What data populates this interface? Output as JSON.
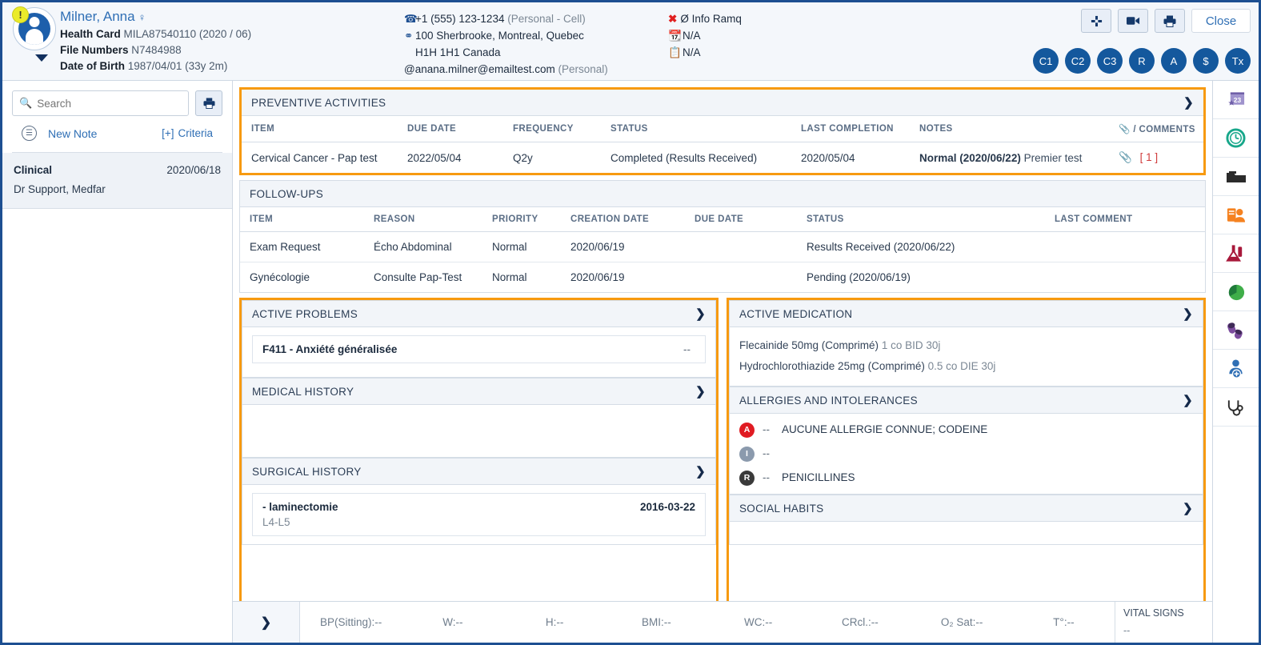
{
  "patient": {
    "name": "Milner, Anna",
    "gender_icon": "female-icon",
    "alert_badge": "!",
    "health_card_label": "Health Card",
    "health_card_value": "MILA87540110 (2020 / 06)",
    "file_numbers_label": "File Numbers",
    "file_numbers_value": "N7484988",
    "dob_label": "Date of Birth",
    "dob_value": "1987/04/01 (33y 2m)"
  },
  "contact": {
    "phone": "+1 (555) 123-1234",
    "phone_type": "(Personal - Cell)",
    "address_line1": "100 Sherbrooke, Montreal, Quebec",
    "address_line2": "H1H 1H1 Canada",
    "email": "@anana.milner@emailtest.com",
    "email_type": "(Personal)"
  },
  "ramq": {
    "info_label": "Ø Info Ramq",
    "row2": "N/A",
    "row3": "N/A"
  },
  "header_actions": {
    "expand_label": "expand-icon",
    "video_label": "video-icon",
    "print_label": "print-icon",
    "close_label": "Close",
    "circles": [
      "C1",
      "C2",
      "C3",
      "R",
      "A",
      "$",
      "Tx"
    ]
  },
  "notes_panel": {
    "search_placeholder": "Search",
    "search_value": "",
    "print_icon": "print-icon",
    "new_note_label": "New Note",
    "criteria_plus": "[+]",
    "criteria_label": "Criteria",
    "note": {
      "title": "Clinical",
      "date": "2020/06/18",
      "author": "Dr Support, Medfar"
    }
  },
  "preventive_activities": {
    "title": "PREVENTIVE ACTIVITIES",
    "columns": [
      "ITEM",
      "DUE DATE",
      "FREQUENCY",
      "STATUS",
      "LAST COMPLETION",
      "NOTES",
      "/ COMMENTS"
    ],
    "rows": [
      {
        "item": "Cervical Cancer - Pap test",
        "due_date": "2022/05/04",
        "frequency": "Q2y",
        "status": "Completed (Results Received)",
        "last_completion": "2020/05/04",
        "notes_bold": "Normal (2020/06/22)",
        "notes_rest": "Premier test",
        "comment_count": "[ 1 ]"
      }
    ]
  },
  "follow_ups": {
    "title": "FOLLOW-UPS",
    "columns": [
      "ITEM",
      "REASON",
      "PRIORITY",
      "CREATION DATE",
      "DUE DATE",
      "STATUS",
      "LAST COMMENT"
    ],
    "rows": [
      {
        "item": "Exam Request",
        "reason": "Écho Abdominal",
        "priority": "Normal",
        "creation_date": "2020/06/19",
        "due_date": "",
        "status": "Results Received (2020/06/22)",
        "last_comment": ""
      },
      {
        "item": "Gynécologie",
        "reason": "Consulte Pap-Test",
        "priority": "Normal",
        "creation_date": "2020/06/19",
        "due_date": "",
        "status": "Pending (2020/06/19)",
        "last_comment": ""
      }
    ]
  },
  "active_problems": {
    "title": "ACTIVE PROBLEMS",
    "rows": [
      {
        "name": "F411 - Anxiété généralisée",
        "value": "--"
      }
    ]
  },
  "medical_history": {
    "title": "MEDICAL HISTORY",
    "rows": []
  },
  "surgical_history": {
    "title": "SURGICAL HISTORY",
    "rows": [
      {
        "name": "- laminectomie",
        "date": "2016-03-22",
        "detail": "L4-L5"
      }
    ]
  },
  "active_medication": {
    "title": "ACTIVE MEDICATION",
    "rows": [
      {
        "name": "Flecainide 50mg (Comprimé)",
        "dose": "1 co BID 30j"
      },
      {
        "name": "Hydrochlorothiazide 25mg (Comprimé)",
        "dose": "0.5 co DIE 30j"
      }
    ]
  },
  "allergies": {
    "title": "ALLERGIES AND INTOLERANCES",
    "rows": [
      {
        "badge": "A",
        "badge_type": "a",
        "dash": "--",
        "text": "AUCUNE ALLERGIE CONNUE; CODEINE"
      },
      {
        "badge": "I",
        "badge_type": "i",
        "dash": "--",
        "text": ""
      },
      {
        "badge": "R",
        "badge_type": "r",
        "dash": "--",
        "text": "PENICILLINES"
      }
    ]
  },
  "social_habits": {
    "title": "SOCIAL HABITS",
    "rows": []
  },
  "vitals": {
    "expand_icon": "chevron-right-icon",
    "items": [
      {
        "label": "BP(Sitting):--"
      },
      {
        "label": "W:--"
      },
      {
        "label": "H:--"
      },
      {
        "label": "BMI:--"
      },
      {
        "label": "WC:--"
      },
      {
        "label": "CRcl.:--"
      },
      {
        "label": "O₂ Sat:--"
      },
      {
        "label": "T°:--"
      }
    ],
    "panel_title": "VITAL SIGNS",
    "panel_value": "--"
  },
  "rail": {
    "items": [
      {
        "icon": "calendar-23-icon"
      },
      {
        "icon": "clock-history-icon"
      },
      {
        "icon": "folder-icon"
      },
      {
        "icon": "patient-record-icon"
      },
      {
        "icon": "lab-flask-icon"
      },
      {
        "icon": "pie-chart-icon"
      },
      {
        "icon": "pills-icon"
      },
      {
        "icon": "add-patient-icon"
      },
      {
        "icon": "stethoscope-icon"
      }
    ]
  },
  "colors": {
    "brand_blue": "#1d4f91",
    "accent_orange": "#f79a10",
    "link_blue": "#2f6fb5",
    "alert_red": "#e01b22"
  }
}
